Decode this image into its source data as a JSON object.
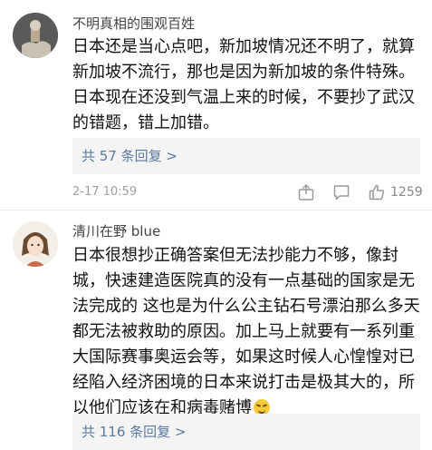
{
  "comments": [
    {
      "username": "不明真相的围观百姓",
      "avatar": "avatar-1",
      "lines": [
        "日本还是当心点吧，新加坡情况还不明了，就算",
        "新加坡不流行，那也是因为新加坡的条件特殊。",
        "日本现在还没到气温上来的时候，不要抄了武汉",
        "的错题，错上加错。"
      ],
      "replies_label": "共 57 条回复 >",
      "time": "2-17 10:59",
      "like_count": "1259"
    },
    {
      "username": "清川在野 blue",
      "avatar": "avatar-2",
      "lines": [
        "日本很想抄正确答案但无法抄能力不够，像封",
        "城，快速建造医院真的没有一点基础的国家是无",
        "法完成的 这也是为什么公主钻石号漂泊那么多天",
        "都无法被救助的原因。加上马上就要有一系列重",
        "大国际赛事奥运会等，如果这时候人心惶惶对已",
        "经陷入经济困境的日本来说打击是极其大的，所",
        "以他们应该在和病毒赌博"
      ],
      "emoji": "laughing-crying-emoji",
      "replies_label": "共 116 条回复 >"
    }
  ],
  "icons": {
    "share": "share-icon",
    "comment": "comment-icon",
    "like": "thumbs-up-icon"
  }
}
